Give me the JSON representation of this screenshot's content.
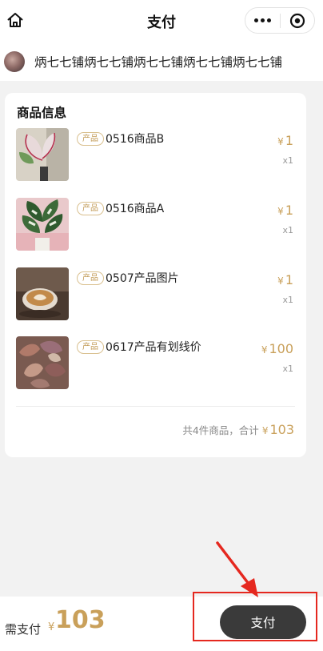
{
  "nav": {
    "title": "支付",
    "icons": {
      "home": "home-icon",
      "more": "more-icon",
      "miniprogram": "target-icon"
    }
  },
  "shop": {
    "name": "炳七七铺炳七七铺炳七七铺炳七七铺炳七七铺"
  },
  "order": {
    "section_title": "商品信息",
    "products": [
      {
        "tag": "产品",
        "name": "0516商品B",
        "currency": "¥",
        "price": "1",
        "qty": "x1"
      },
      {
        "tag": "产品",
        "name": "0516商品A",
        "currency": "¥",
        "price": "1",
        "qty": "x1"
      },
      {
        "tag": "产品",
        "name": "0507产品图片",
        "currency": "¥",
        "price": "1",
        "qty": "x1"
      },
      {
        "tag": "产品",
        "name": "0617产品有划线价",
        "currency": "¥",
        "price": "100",
        "qty": "x1"
      }
    ],
    "summary_text": "共4件商品，合计",
    "summary_currency": "¥",
    "summary_total": "103"
  },
  "bottom": {
    "need_label": "需支付",
    "currency": "¥",
    "amount": "103",
    "pay_label": "支付"
  },
  "colors": {
    "accent_gold": "#c9a05a",
    "pay_button": "#3a3a3a",
    "annotation_red": "#e5281f"
  }
}
